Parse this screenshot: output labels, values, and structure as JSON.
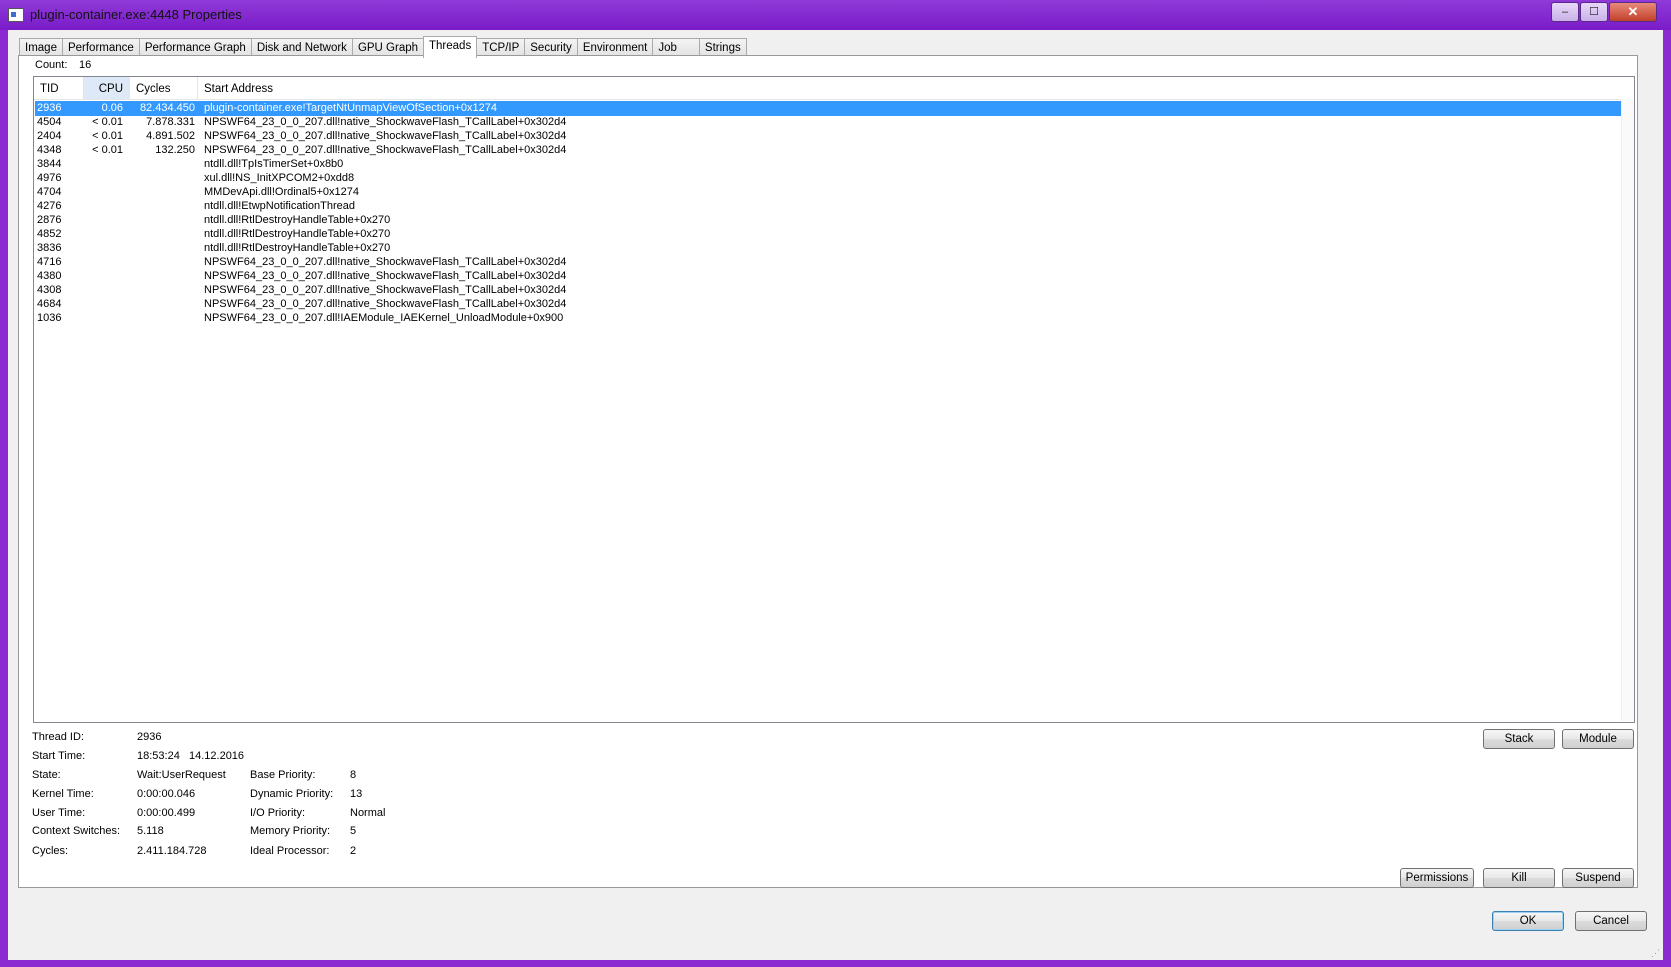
{
  "window": {
    "title": "plugin-container.exe:4448 Properties",
    "controls": {
      "minimize": "–",
      "maximize": "☐",
      "close": "✕"
    }
  },
  "tabs": [
    {
      "label": "Image"
    },
    {
      "label": "Performance"
    },
    {
      "label": "Performance Graph"
    },
    {
      "label": "Disk and Network"
    },
    {
      "label": "GPU Graph"
    },
    {
      "label": "Threads",
      "active": true
    },
    {
      "label": "TCP/IP"
    },
    {
      "label": "Security"
    },
    {
      "label": "Environment"
    },
    {
      "label": "Job"
    },
    {
      "label": "Strings"
    }
  ],
  "threads": {
    "count_label": "Count:",
    "count_value": "16",
    "columns": {
      "tid": "TID",
      "cpu": "CPU",
      "cycles": "Cycles Delta",
      "address": "Start Address"
    },
    "sorted_column": "cpu",
    "rows": [
      {
        "tid": "2936",
        "cpu": "0.06",
        "cycles": "82.434.450",
        "address": "plugin-container.exe!TargetNtUnmapViewOfSection+0x1274",
        "selected": true
      },
      {
        "tid": "4504",
        "cpu": "< 0.01",
        "cycles": "7.878.331",
        "address": "NPSWF64_23_0_0_207.dll!native_ShockwaveFlash_TCallLabel+0x302d4"
      },
      {
        "tid": "2404",
        "cpu": "< 0.01",
        "cycles": "4.891.502",
        "address": "NPSWF64_23_0_0_207.dll!native_ShockwaveFlash_TCallLabel+0x302d4"
      },
      {
        "tid": "4348",
        "cpu": "< 0.01",
        "cycles": "132.250",
        "address": "NPSWF64_23_0_0_207.dll!native_ShockwaveFlash_TCallLabel+0x302d4"
      },
      {
        "tid": "3844",
        "cpu": "",
        "cycles": "",
        "address": "ntdll.dll!TpIsTimerSet+0x8b0"
      },
      {
        "tid": "4976",
        "cpu": "",
        "cycles": "",
        "address": "xul.dll!NS_InitXPCOM2+0xdd8"
      },
      {
        "tid": "4704",
        "cpu": "",
        "cycles": "",
        "address": "MMDevApi.dll!Ordinal5+0x1274"
      },
      {
        "tid": "4276",
        "cpu": "",
        "cycles": "",
        "address": "ntdll.dll!EtwpNotificationThread"
      },
      {
        "tid": "2876",
        "cpu": "",
        "cycles": "",
        "address": "ntdll.dll!RtlDestroyHandleTable+0x270"
      },
      {
        "tid": "4852",
        "cpu": "",
        "cycles": "",
        "address": "ntdll.dll!RtlDestroyHandleTable+0x270"
      },
      {
        "tid": "3836",
        "cpu": "",
        "cycles": "",
        "address": "ntdll.dll!RtlDestroyHandleTable+0x270"
      },
      {
        "tid": "4716",
        "cpu": "",
        "cycles": "",
        "address": "NPSWF64_23_0_0_207.dll!native_ShockwaveFlash_TCallLabel+0x302d4"
      },
      {
        "tid": "4380",
        "cpu": "",
        "cycles": "",
        "address": "NPSWF64_23_0_0_207.dll!native_ShockwaveFlash_TCallLabel+0x302d4"
      },
      {
        "tid": "4308",
        "cpu": "",
        "cycles": "",
        "address": "NPSWF64_23_0_0_207.dll!native_ShockwaveFlash_TCallLabel+0x302d4"
      },
      {
        "tid": "4684",
        "cpu": "",
        "cycles": "",
        "address": "NPSWF64_23_0_0_207.dll!native_ShockwaveFlash_TCallLabel+0x302d4"
      },
      {
        "tid": "1036",
        "cpu": "",
        "cycles": "",
        "address": "NPSWF64_23_0_0_207.dll!IAEModule_IAEKernel_UnloadModule+0x900"
      }
    ]
  },
  "details": {
    "thread_id": {
      "label": "Thread ID:",
      "value": "2936"
    },
    "start_time": {
      "label": "Start Time:",
      "value": "18:53:24   14.12.2016"
    },
    "state": {
      "label": "State:",
      "value": "Wait:UserRequest"
    },
    "kernel_time": {
      "label": "Kernel Time:",
      "value": "0:00:00.046"
    },
    "user_time": {
      "label": "User Time:",
      "value": "0:00:00.499"
    },
    "context_switches": {
      "label": "Context Switches:",
      "value": "5.118"
    },
    "cycles": {
      "label": "Cycles:",
      "value": "2.411.184.728"
    },
    "base_priority": {
      "label": "Base Priority:",
      "value": "8"
    },
    "dynamic_priority": {
      "label": "Dynamic Priority:",
      "value": "13"
    },
    "io_priority": {
      "label": "I/O Priority:",
      "value": "Normal"
    },
    "memory_priority": {
      "label": "Memory Priority:",
      "value": "5"
    },
    "ideal_processor": {
      "label": "Ideal Processor:",
      "value": "2"
    }
  },
  "buttons": {
    "stack": "Stack",
    "module": "Module",
    "permissions": "Permissions",
    "kill": "Kill",
    "suspend": "Suspend",
    "ok": "OK",
    "cancel": "Cancel"
  }
}
